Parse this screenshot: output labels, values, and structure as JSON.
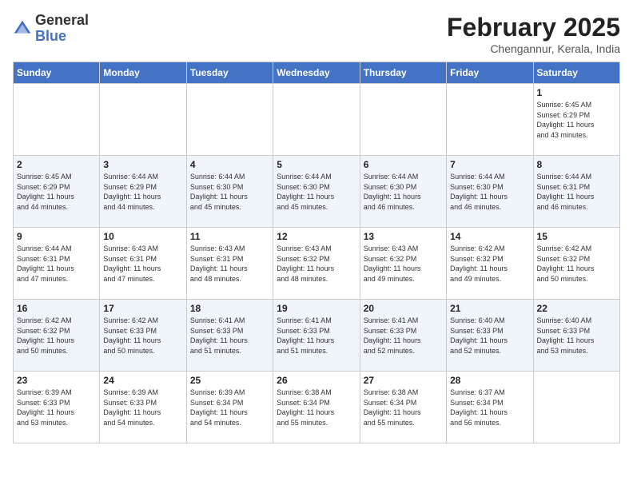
{
  "header": {
    "logo_general": "General",
    "logo_blue": "Blue",
    "month_title": "February 2025",
    "location": "Chengannur, Kerala, India"
  },
  "days_of_week": [
    "Sunday",
    "Monday",
    "Tuesday",
    "Wednesday",
    "Thursday",
    "Friday",
    "Saturday"
  ],
  "weeks": [
    [
      {
        "day": "",
        "info": ""
      },
      {
        "day": "",
        "info": ""
      },
      {
        "day": "",
        "info": ""
      },
      {
        "day": "",
        "info": ""
      },
      {
        "day": "",
        "info": ""
      },
      {
        "day": "",
        "info": ""
      },
      {
        "day": "1",
        "info": "Sunrise: 6:45 AM\nSunset: 6:29 PM\nDaylight: 11 hours\nand 43 minutes."
      }
    ],
    [
      {
        "day": "2",
        "info": "Sunrise: 6:45 AM\nSunset: 6:29 PM\nDaylight: 11 hours\nand 44 minutes."
      },
      {
        "day": "3",
        "info": "Sunrise: 6:44 AM\nSunset: 6:29 PM\nDaylight: 11 hours\nand 44 minutes."
      },
      {
        "day": "4",
        "info": "Sunrise: 6:44 AM\nSunset: 6:30 PM\nDaylight: 11 hours\nand 45 minutes."
      },
      {
        "day": "5",
        "info": "Sunrise: 6:44 AM\nSunset: 6:30 PM\nDaylight: 11 hours\nand 45 minutes."
      },
      {
        "day": "6",
        "info": "Sunrise: 6:44 AM\nSunset: 6:30 PM\nDaylight: 11 hours\nand 46 minutes."
      },
      {
        "day": "7",
        "info": "Sunrise: 6:44 AM\nSunset: 6:30 PM\nDaylight: 11 hours\nand 46 minutes."
      },
      {
        "day": "8",
        "info": "Sunrise: 6:44 AM\nSunset: 6:31 PM\nDaylight: 11 hours\nand 46 minutes."
      }
    ],
    [
      {
        "day": "9",
        "info": "Sunrise: 6:44 AM\nSunset: 6:31 PM\nDaylight: 11 hours\nand 47 minutes."
      },
      {
        "day": "10",
        "info": "Sunrise: 6:43 AM\nSunset: 6:31 PM\nDaylight: 11 hours\nand 47 minutes."
      },
      {
        "day": "11",
        "info": "Sunrise: 6:43 AM\nSunset: 6:31 PM\nDaylight: 11 hours\nand 48 minutes."
      },
      {
        "day": "12",
        "info": "Sunrise: 6:43 AM\nSunset: 6:32 PM\nDaylight: 11 hours\nand 48 minutes."
      },
      {
        "day": "13",
        "info": "Sunrise: 6:43 AM\nSunset: 6:32 PM\nDaylight: 11 hours\nand 49 minutes."
      },
      {
        "day": "14",
        "info": "Sunrise: 6:42 AM\nSunset: 6:32 PM\nDaylight: 11 hours\nand 49 minutes."
      },
      {
        "day": "15",
        "info": "Sunrise: 6:42 AM\nSunset: 6:32 PM\nDaylight: 11 hours\nand 50 minutes."
      }
    ],
    [
      {
        "day": "16",
        "info": "Sunrise: 6:42 AM\nSunset: 6:32 PM\nDaylight: 11 hours\nand 50 minutes."
      },
      {
        "day": "17",
        "info": "Sunrise: 6:42 AM\nSunset: 6:33 PM\nDaylight: 11 hours\nand 50 minutes."
      },
      {
        "day": "18",
        "info": "Sunrise: 6:41 AM\nSunset: 6:33 PM\nDaylight: 11 hours\nand 51 minutes."
      },
      {
        "day": "19",
        "info": "Sunrise: 6:41 AM\nSunset: 6:33 PM\nDaylight: 11 hours\nand 51 minutes."
      },
      {
        "day": "20",
        "info": "Sunrise: 6:41 AM\nSunset: 6:33 PM\nDaylight: 11 hours\nand 52 minutes."
      },
      {
        "day": "21",
        "info": "Sunrise: 6:40 AM\nSunset: 6:33 PM\nDaylight: 11 hours\nand 52 minutes."
      },
      {
        "day": "22",
        "info": "Sunrise: 6:40 AM\nSunset: 6:33 PM\nDaylight: 11 hours\nand 53 minutes."
      }
    ],
    [
      {
        "day": "23",
        "info": "Sunrise: 6:39 AM\nSunset: 6:33 PM\nDaylight: 11 hours\nand 53 minutes."
      },
      {
        "day": "24",
        "info": "Sunrise: 6:39 AM\nSunset: 6:33 PM\nDaylight: 11 hours\nand 54 minutes."
      },
      {
        "day": "25",
        "info": "Sunrise: 6:39 AM\nSunset: 6:34 PM\nDaylight: 11 hours\nand 54 minutes."
      },
      {
        "day": "26",
        "info": "Sunrise: 6:38 AM\nSunset: 6:34 PM\nDaylight: 11 hours\nand 55 minutes."
      },
      {
        "day": "27",
        "info": "Sunrise: 6:38 AM\nSunset: 6:34 PM\nDaylight: 11 hours\nand 55 minutes."
      },
      {
        "day": "28",
        "info": "Sunrise: 6:37 AM\nSunset: 6:34 PM\nDaylight: 11 hours\nand 56 minutes."
      },
      {
        "day": "",
        "info": ""
      }
    ]
  ]
}
